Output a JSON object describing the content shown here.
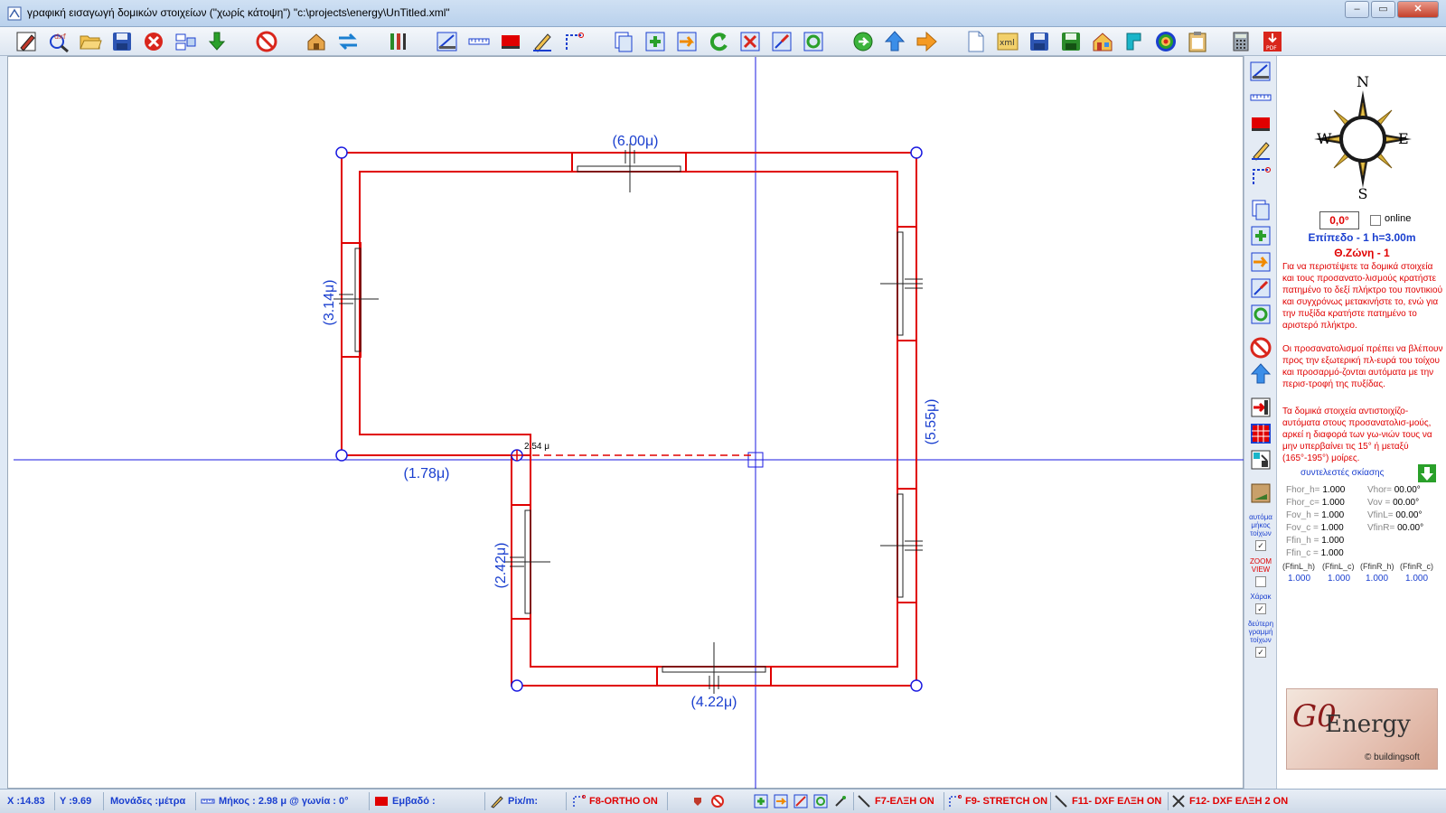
{
  "window": {
    "title": "γραφική εισαγωγή δομικών στοιχείων (\"χωρίς κάτοψη\") \"c:\\projects\\energy\\UnTitled.xml\"",
    "minimize": "‒",
    "maximize": "▭",
    "close": "✕"
  },
  "toolbar": {
    "icons": [
      "pencil-edit-icon",
      "dxf-icon",
      "open-folder-icon",
      "save-icon",
      "delete-icon",
      "layers-icon",
      "download-arrow-icon",
      "forbidden-icon",
      "house-tool-icon",
      "swap-arrows-icon",
      "tools-icon",
      "wall-draw-icon",
      "ruler-icon",
      "red-block-icon",
      "edit-pen-icon",
      "corner-dashed-icon",
      "copy-page-icon",
      "add-element-icon",
      "move-element-icon",
      "rotate-green-icon",
      "delete-element-icon",
      "stretch-icon",
      "refresh-icon",
      "globe-arrow-icon",
      "up-arrow-icon",
      "right-arrow-icon",
      "new-document-icon",
      "xml-icon",
      "save-disk-icon",
      "save-green-icon",
      "house-color-icon",
      "cyan-tool-icon",
      "target-icon",
      "clipboard-icon",
      "calculator-icon",
      "pdf-icon"
    ]
  },
  "drawing": {
    "dim_top": "(6.00μ)",
    "dim_left": "(3.14μ)",
    "dim_right": "(5.55μ)",
    "dim_mid": "(1.78μ)",
    "dim_lower_left": "(2.42μ)",
    "dim_bottom": "(4.22μ)",
    "segment_length": "2.54 μ",
    "colors": {
      "wall": "#e00000",
      "axis": "#1a1ae0",
      "dim": "#1a3fcf"
    }
  },
  "side_tools": {
    "icons": [
      "wall-draw-icon",
      "ruler-icon",
      "red-block-icon",
      "edit-pen-icon",
      "corner-dashed-icon",
      "copy-page-icon",
      "add-element-icon",
      "move-element-icon",
      "stretch-icon",
      "refresh-icon",
      "forbidden-icon",
      "up-arrow-icon",
      "exit-door-icon",
      "table-grid-icon",
      "swap-windows-icon",
      "shade-icon"
    ],
    "auto_wall_label": "αυτόμα μήκος τοίχων",
    "zoom_view_label": "ZOOM VIEW",
    "charak_label": "Χάρακ",
    "second_line_label": "δεύτερη γραμμή τοίχων"
  },
  "panel": {
    "compass": {
      "n": "N",
      "s": "S",
      "e": "E",
      "w": "W"
    },
    "angle": "0,0°",
    "online_label": "online",
    "level": "Επίπεδο - 1  h=3.00m",
    "zone": "Θ.Ζώνη - 1",
    "help1": "Για να περιστέψετε τα δομικά στοιχεία και τους προσανατο-λισμούς κρατήστε πατημένο το δεξί πλήκτρο του ποντικιού και συγχρόνως μετακινήστε το, ενώ για την πυξίδα κρατήστε πατημένο το αριστερό πλήκτρο.",
    "help2": "Οι προσανατολισμοί πρέπει να βλέπουν προς την εξωτερική πλ-ευρά του τοίχου και προσαρμό-ζονται αυτόματα με την περισ-τροφή της πυξίδας.",
    "help3": "Τα δομικά στοιχεία αντιστοιχίζο-αυτόματα στους προσανατολισ-μούς, αρκεί η διαφορά των γω-νιών τους να μην υπερβαίνει τις 15° ή μεταξύ (165°-195°) μοίρες.",
    "shade_title": "συντελεστές σκίασης",
    "factors_left": [
      {
        "k": "Fhor_h=",
        "v": "1.000"
      },
      {
        "k": "Fhor_c=",
        "v": "1.000"
      },
      {
        "k": "Fov_h =",
        "v": "1.000"
      },
      {
        "k": "Fov_c =",
        "v": "1.000"
      },
      {
        "k": "Ffin_h =",
        "v": "1.000"
      },
      {
        "k": "Ffin_c =",
        "v": "1.000"
      }
    ],
    "factors_right": [
      {
        "k": "Vhor=",
        "v": "00.00°"
      },
      {
        "k": "Vov =",
        "v": "00.00°"
      },
      {
        "k": "VfinL=",
        "v": "00.00°"
      },
      {
        "k": "VfinR=",
        "v": "00.00°"
      }
    ],
    "fin_keys": [
      "(FfinL_h)",
      "(FfinL_c)",
      "(FfinR_h)",
      "(FfinR_c)"
    ],
    "fin_vals": [
      "1.000",
      "1.000",
      "1.000",
      "1.000"
    ],
    "logo": {
      "go": "G0",
      "energy": "Energy",
      "company": "© buildingsoft"
    }
  },
  "status": {
    "x": "X :14.83",
    "y": "Y :9.69",
    "units": "Μονάδες :μέτρα",
    "length": "Μήκος : 2.98 μ @ γωνία :   0°",
    "area": "Εμβαδό :",
    "pix": "Pix/m:",
    "f8": "F8-ORTHO ON",
    "f7": "F7-ΕΛΞΗ ON",
    "f9": "F9- STRETCH ON",
    "f11": "F11- DXF ΕΛΞΗ ON",
    "f12": "F12- DXF ΕΛΞΗ 2 ON"
  }
}
